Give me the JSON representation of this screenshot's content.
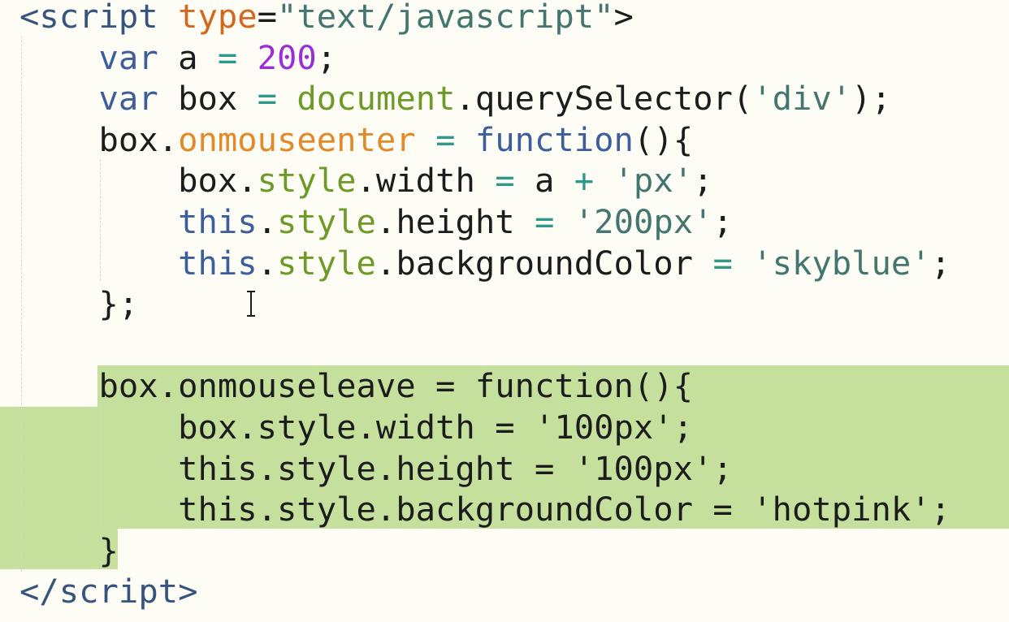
{
  "editor": {
    "language": "javascript",
    "selection_color": "#c5df9d",
    "background_color": "#fdfdf5",
    "lines": [
      [
        {
          "text": "<",
          "kind": "tag"
        },
        {
          "text": "script",
          "kind": "tag"
        },
        {
          "text": " ",
          "kind": "plain"
        },
        {
          "text": "type",
          "kind": "attr"
        },
        {
          "text": "=",
          "kind": "plain"
        },
        {
          "text": "\"text/javascript\"",
          "kind": "str"
        },
        {
          "text": ">",
          "kind": "plain"
        }
      ],
      [
        {
          "text": "    ",
          "kind": "plain"
        },
        {
          "text": "var",
          "kind": "kw"
        },
        {
          "text": " a ",
          "kind": "plain"
        },
        {
          "text": "=",
          "kind": "op"
        },
        {
          "text": " ",
          "kind": "plain"
        },
        {
          "text": "200",
          "kind": "num"
        },
        {
          "text": ";",
          "kind": "plain"
        }
      ],
      [
        {
          "text": "    ",
          "kind": "plain"
        },
        {
          "text": "var",
          "kind": "kw"
        },
        {
          "text": " box ",
          "kind": "plain"
        },
        {
          "text": "=",
          "kind": "op"
        },
        {
          "text": " ",
          "kind": "plain"
        },
        {
          "text": "document",
          "kind": "prop"
        },
        {
          "text": ".querySelector(",
          "kind": "plain"
        },
        {
          "text": "'div'",
          "kind": "str"
        },
        {
          "text": ");",
          "kind": "plain"
        }
      ],
      [
        {
          "text": "    box.",
          "kind": "plain"
        },
        {
          "text": "onmouseenter",
          "kind": "event"
        },
        {
          "text": " ",
          "kind": "plain"
        },
        {
          "text": "=",
          "kind": "op"
        },
        {
          "text": " ",
          "kind": "plain"
        },
        {
          "text": "function",
          "kind": "kw"
        },
        {
          "text": "(){",
          "kind": "plain"
        }
      ],
      [
        {
          "text": "        box.",
          "kind": "plain"
        },
        {
          "text": "style",
          "kind": "prop"
        },
        {
          "text": ".width ",
          "kind": "plain"
        },
        {
          "text": "=",
          "kind": "op"
        },
        {
          "text": " a ",
          "kind": "plain"
        },
        {
          "text": "+",
          "kind": "op"
        },
        {
          "text": " ",
          "kind": "plain"
        },
        {
          "text": "'px'",
          "kind": "str"
        },
        {
          "text": ";",
          "kind": "plain"
        }
      ],
      [
        {
          "text": "        ",
          "kind": "plain"
        },
        {
          "text": "this",
          "kind": "kw"
        },
        {
          "text": ".",
          "kind": "plain"
        },
        {
          "text": "style",
          "kind": "prop"
        },
        {
          "text": ".height ",
          "kind": "plain"
        },
        {
          "text": "=",
          "kind": "op"
        },
        {
          "text": " ",
          "kind": "plain"
        },
        {
          "text": "'200px'",
          "kind": "str"
        },
        {
          "text": ";",
          "kind": "plain"
        }
      ],
      [
        {
          "text": "        ",
          "kind": "plain"
        },
        {
          "text": "this",
          "kind": "kw"
        },
        {
          "text": ".",
          "kind": "plain"
        },
        {
          "text": "style",
          "kind": "prop"
        },
        {
          "text": ".backgroundColor ",
          "kind": "plain"
        },
        {
          "text": "=",
          "kind": "op"
        },
        {
          "text": " ",
          "kind": "plain"
        },
        {
          "text": "'skyblue'",
          "kind": "str"
        },
        {
          "text": ";",
          "kind": "plain"
        }
      ],
      [
        {
          "text": "    };",
          "kind": "plain"
        }
      ],
      [
        {
          "text": "",
          "kind": "plain"
        }
      ],
      [
        {
          "text": "    box.onmouseleave = function(){",
          "kind": "plain"
        }
      ],
      [
        {
          "text": "        box.style.width = '100px';",
          "kind": "plain"
        }
      ],
      [
        {
          "text": "        this.style.height = '100px';",
          "kind": "plain"
        }
      ],
      [
        {
          "text": "        this.style.backgroundColor = 'hotpink';",
          "kind": "plain"
        }
      ],
      [
        {
          "text": "    }",
          "kind": "plain"
        }
      ],
      [
        {
          "text": "</",
          "kind": "tag"
        },
        {
          "text": "script",
          "kind": "tag"
        },
        {
          "text": ">",
          "kind": "tag"
        }
      ]
    ]
  },
  "icons": {
    "text_cursor": "i-beam-cursor-icon"
  }
}
